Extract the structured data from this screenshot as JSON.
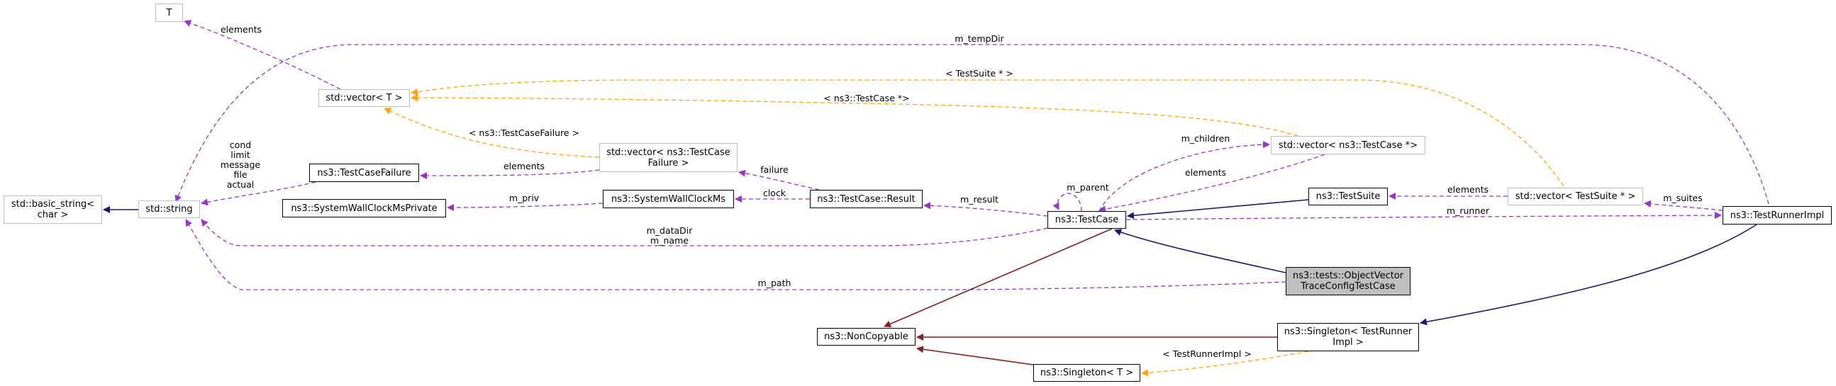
{
  "colors": {
    "member": "#9a32cd",
    "template": "#ffa500",
    "inherit_public": "#191970",
    "inherit_private": "#8b1a1a",
    "highlight_fill": "#bfbfbf"
  },
  "nodes": [
    {
      "id": "T",
      "label": "T",
      "kind": "ext"
    },
    {
      "id": "vecT",
      "label": "std::vector< T >",
      "kind": "ext"
    },
    {
      "id": "basic",
      "label": "std::basic_string<\nchar >",
      "kind": "ext"
    },
    {
      "id": "string",
      "label": "std::string",
      "kind": "ext"
    },
    {
      "id": "tcf",
      "label": "ns3::TestCaseFailure",
      "kind": "doc"
    },
    {
      "id": "swcp",
      "label": "ns3::SystemWallClockMsPrivate",
      "kind": "doc"
    },
    {
      "id": "vecTCF",
      "label": "std::vector< ns3::TestCase\nFailure >",
      "kind": "ext"
    },
    {
      "id": "swc",
      "label": "ns3::SystemWallClockMs",
      "kind": "doc"
    },
    {
      "id": "result",
      "label": "ns3::TestCase::Result",
      "kind": "doc"
    },
    {
      "id": "testcase",
      "label": "ns3::TestCase",
      "kind": "doc"
    },
    {
      "id": "noncopy",
      "label": "ns3::NonCopyable",
      "kind": "doc"
    },
    {
      "id": "singT",
      "label": "ns3::Singleton< T >",
      "kind": "doc"
    },
    {
      "id": "vecTC",
      "label": "std::vector< ns3::TestCase *>",
      "kind": "ext"
    },
    {
      "id": "suite",
      "label": "ns3::TestSuite",
      "kind": "doc"
    },
    {
      "id": "vecTS",
      "label": "std::vector< TestSuite * >",
      "kind": "ext"
    },
    {
      "id": "runner",
      "label": "ns3::TestRunnerImpl",
      "kind": "doc"
    },
    {
      "id": "objvec",
      "label": "ns3::tests::ObjectVector\nTraceConfigTestCase",
      "kind": "cur"
    },
    {
      "id": "singTR",
      "label": "ns3::Singleton< TestRunner\nImpl >",
      "kind": "doc"
    }
  ],
  "edges": [
    {
      "from": "vecT",
      "to": "T",
      "label": "elements",
      "type": "member"
    },
    {
      "from": "runner",
      "to": "string",
      "label": "m_tempDir",
      "type": "member"
    },
    {
      "from": "vecTS",
      "to": "vecT",
      "label": "< TestSuite * >",
      "type": "template"
    },
    {
      "from": "vecTC",
      "to": "vecT",
      "label": "< ns3::TestCase *>",
      "type": "template"
    },
    {
      "from": "vecTCF",
      "to": "vecT",
      "label": "< ns3::TestCaseFailure >",
      "type": "template"
    },
    {
      "from": "vecTCF",
      "to": "tcf",
      "label": "elements",
      "type": "member"
    },
    {
      "from": "tcf",
      "to": "string",
      "label": "cond\nlimit\nmessage\nfile\nactual",
      "type": "member"
    },
    {
      "from": "string",
      "to": "basic",
      "label": "",
      "type": "inherit_public"
    },
    {
      "from": "swc",
      "to": "swcp",
      "label": "m_priv",
      "type": "member"
    },
    {
      "from": "result",
      "to": "swc",
      "label": "clock",
      "type": "member"
    },
    {
      "from": "result",
      "to": "vecTCF",
      "label": "failure",
      "type": "member"
    },
    {
      "from": "testcase",
      "to": "result",
      "label": "m_result",
      "type": "member"
    },
    {
      "from": "testcase",
      "to": "string",
      "label": "m_dataDir\nm_name",
      "type": "member"
    },
    {
      "from": "objvec",
      "to": "string",
      "label": "m_path",
      "type": "member"
    },
    {
      "from": "testcase",
      "to": "testcase",
      "label": "m_parent",
      "type": "member"
    },
    {
      "from": "testcase",
      "to": "vecTC",
      "label": "m_children",
      "type": "member"
    },
    {
      "from": "vecTC",
      "to": "testcase",
      "label": "elements",
      "type": "member"
    },
    {
      "from": "suite",
      "to": "testcase",
      "label": "",
      "type": "inherit_public"
    },
    {
      "from": "testcase",
      "to": "runner",
      "label": "m_runner",
      "type": "member"
    },
    {
      "from": "vecTS",
      "to": "suite",
      "label": "elements",
      "type": "member"
    },
    {
      "from": "runner",
      "to": "vecTS",
      "label": "m_suites",
      "type": "member"
    },
    {
      "from": "objvec",
      "to": "testcase",
      "label": "",
      "type": "inherit_public"
    },
    {
      "from": "testcase",
      "to": "noncopy",
      "label": "",
      "type": "inherit_private"
    },
    {
      "from": "singTR",
      "to": "noncopy",
      "label": "",
      "type": "inherit_private"
    },
    {
      "from": "singT",
      "to": "noncopy",
      "label": "",
      "type": "inherit_private"
    },
    {
      "from": "singTR",
      "to": "singT",
      "label": "< TestRunnerImpl >",
      "type": "template"
    },
    {
      "from": "runner",
      "to": "singTR",
      "label": "",
      "type": "inherit_public"
    }
  ]
}
